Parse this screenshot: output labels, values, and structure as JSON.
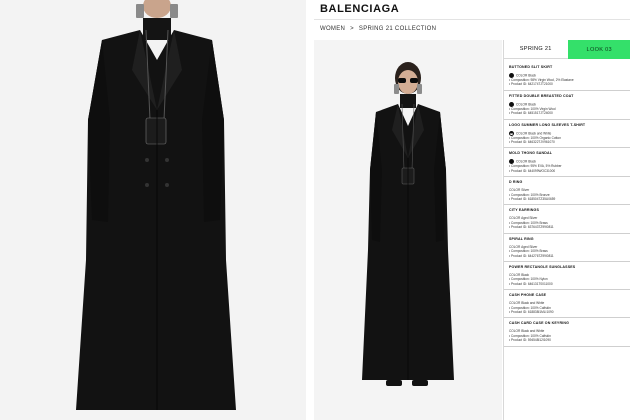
{
  "header": {
    "brand": "BALENCIAGA",
    "breadcrumb": [
      "WOMEN",
      ">",
      "SPRING 21 COLLECTION"
    ]
  },
  "tabs": {
    "season": "SPRING 21",
    "look": "LOOK 03"
  },
  "colors": {
    "look_tab": "#34e06a",
    "coat": "#111111",
    "background": "#f3f3f3"
  },
  "items": [
    {
      "title": "BUTTONED SLIT SKIRT",
      "color_label": "COLOR",
      "color": "Black",
      "composition": "• Composition: 98% Virgin Wool, 2% Elastane",
      "product_id": "• Product ID: 642174TJT21000"
    },
    {
      "title": "FITTED DOUBLE BREASTED COAT",
      "color_label": "COLOR",
      "color": "Black",
      "composition": "• Composition: 100% Virgin Wool",
      "product_id": "• Product ID: 645151TJT24000"
    },
    {
      "title": "LOGO SUMMER LONG SLEEVES T-SHIRT",
      "color_label": "COLOR",
      "color": "Black and White",
      "composition": "• Composition: 100% Organic Cotton",
      "product_id": "• Product ID: 646322TJV961070"
    },
    {
      "title": "MOLD THONG SANDAL",
      "color_label": "COLOR",
      "color": "Black",
      "composition": "• Composition: 95% EVA, 5% Rubber",
      "product_id": "• Product ID: 644099WOC31000"
    },
    {
      "title": "D RING",
      "color_label": "COLOR",
      "color": "Silver",
      "composition": "• Composition: 100% Bronze",
      "product_id": "• Product ID: 618504TZ35U0659"
    },
    {
      "title": "CITY EARRINGS",
      "color_label": "COLOR",
      "color": "Aged Silver",
      "composition": "• Composition: 100% Brass",
      "product_id": "• Product ID: 637643TZ99I0811"
    },
    {
      "title": "SPIRAL RING",
      "color_label": "COLOR",
      "color": "Aged Silver",
      "composition": "• Composition: 100% Brass",
      "product_id": "• Product ID: 644276TZ99I0811"
    },
    {
      "title": "POWER RECTANGLE SUNGLASSES",
      "color_label": "COLOR",
      "color": "Black",
      "composition": "• Composition: 100% Nylon",
      "product_id": "• Product ID: 646131T0011000"
    },
    {
      "title": "CASH PHONE CASE",
      "color_label": "COLOR",
      "color": "Black and White",
      "composition": "• Composition: 100% Calfskin",
      "product_id": "• Product ID: 618838I1MLI1090"
    },
    {
      "title": "CASH CARD CASE ON KEYRING",
      "color_label": "COLOR",
      "color": "Black and White",
      "composition": "• Composition: 100% Calfskin",
      "product_id": "• Product ID: 594548I12I1090"
    }
  ]
}
